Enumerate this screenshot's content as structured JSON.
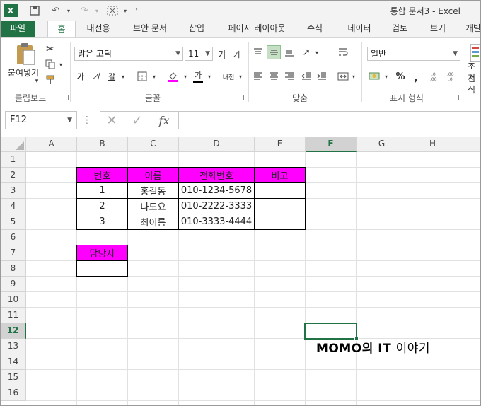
{
  "title": "통합 문서3 - Excel",
  "tabs": [
    "파일",
    "홈",
    "내전용",
    "보안 문서",
    "삽입",
    "페이지 레이아웃",
    "수식",
    "데이터",
    "검토",
    "보기",
    "개발"
  ],
  "active_tab": "홈",
  "ribbon": {
    "clipboard": {
      "paste_label": "붙여넣기",
      "group_label": "클립보드"
    },
    "font": {
      "name": "맑은 고딕",
      "size": "11",
      "bold": "가",
      "italic": "가",
      "underline": "갈",
      "grow": "가",
      "shrink": "가",
      "font_color": "가",
      "phonetic": "내천",
      "group_label": "글꼴"
    },
    "alignment": {
      "group_label": "맞춤"
    },
    "number": {
      "format": "일반",
      "percent": "%",
      "comma": ",",
      "group_label": "표시 형식"
    },
    "styles": {
      "label_line1": "조건",
      "label_line2": "서식"
    }
  },
  "formula_bar": {
    "name_box": "F12",
    "fx": "fx",
    "value": ""
  },
  "columns": [
    "A",
    "B",
    "C",
    "D",
    "E",
    "F",
    "G",
    "H"
  ],
  "selected_column": "F",
  "rows": [
    "1",
    "2",
    "3",
    "4",
    "5",
    "6",
    "7",
    "8",
    "9",
    "10",
    "11",
    "12",
    "13",
    "14",
    "15",
    "16"
  ],
  "selected_row": "12",
  "table": {
    "headers": [
      "번호",
      "이름",
      "전화번호",
      "비고"
    ],
    "rows": [
      [
        "1",
        "홍길동",
        "010-1234-5678",
        ""
      ],
      [
        "2",
        "나도요",
        "010-2222-3333",
        ""
      ],
      [
        "3",
        "최이름",
        "010-3333-4444",
        ""
      ]
    ]
  },
  "manager": {
    "header": "담당자",
    "value": ""
  },
  "watermark": {
    "bold": "MOMO의 IT",
    "rest": "이야기"
  },
  "colors": {
    "excel_green": "#217346",
    "header_fill": "#ff00ff"
  }
}
